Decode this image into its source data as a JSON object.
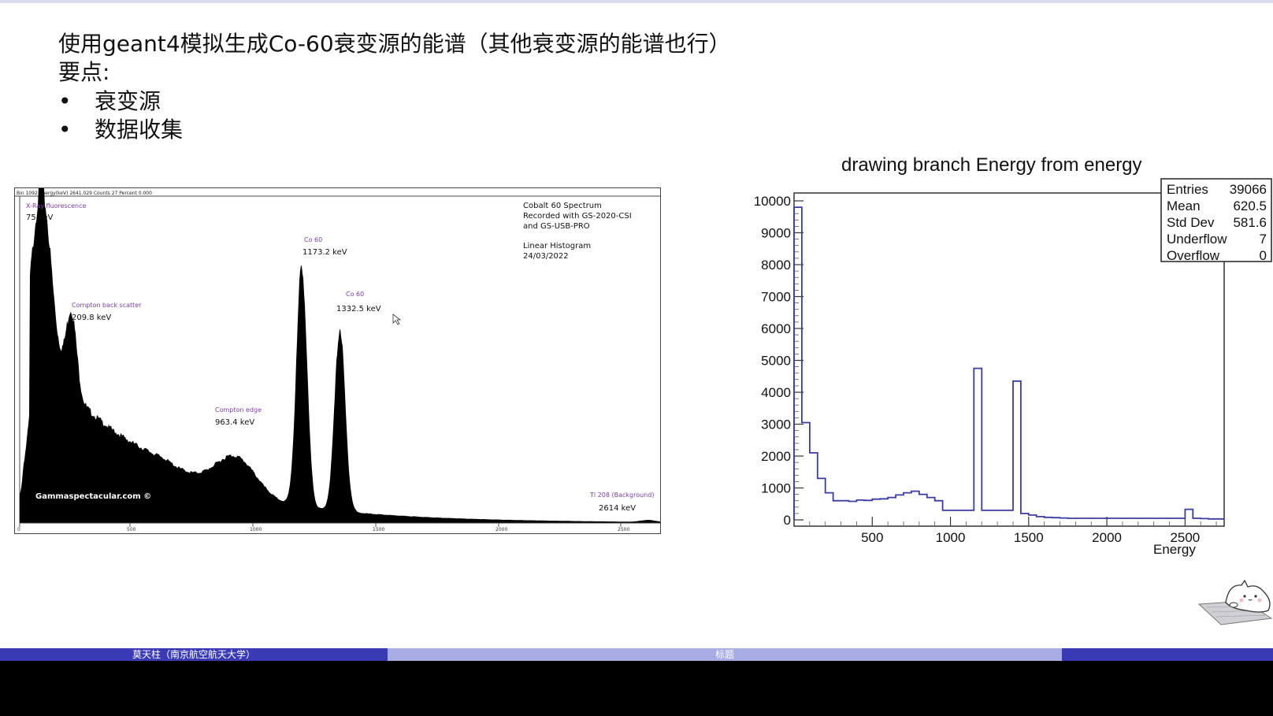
{
  "slide": {
    "title": "使用geant4模拟生成Co-60衰变源的能谱（其他衰变源的能谱也行）",
    "subtitle": "要点:",
    "bullets": [
      "衰变源",
      "数据收集"
    ]
  },
  "footer": {
    "left": "莫天柱（南京航空航天大学）",
    "center": "标题",
    "right": ""
  },
  "left_figure": {
    "status_bar": "Bin 1092  Energy(keV) 2641.029  Counts 27  Percent 0.000",
    "info_lines": [
      "Cobalt 60 Spectrum",
      "Recorded with GS-2020-CSI",
      "and GS-USB-PRO",
      "Linear Histogram",
      "24/03/2022"
    ],
    "watermark": "Gammaspectacular.com ©",
    "peaks": [
      {
        "label": "X-Ray fluorescence",
        "energy": "75 keV"
      },
      {
        "label": "Compton back scatter",
        "energy": "209.8 keV"
      },
      {
        "label": "Compton edge",
        "energy": "963.4 keV"
      },
      {
        "label": "Co 60",
        "energy": "1173.2 keV"
      },
      {
        "label": "Co 60",
        "energy": "1332.5 keV"
      },
      {
        "label": "Tl 208 (Background)",
        "energy": "2614 keV"
      }
    ],
    "x_ticks": [
      "0",
      "500",
      "1000",
      "1500",
      "2000",
      "2500"
    ],
    "fill_color": "#000000",
    "label_color": "#7a3fa0"
  },
  "chart_data": {
    "type": "bar",
    "title": "drawing branch Energy from energy",
    "xlabel": "Energy",
    "ylabel": "",
    "xlim": [
      0,
      2750
    ],
    "ylim": [
      0,
      10000
    ],
    "x_ticks": [
      500,
      1000,
      1500,
      2000,
      2500
    ],
    "y_ticks": [
      0,
      1000,
      2000,
      3000,
      4000,
      5000,
      6000,
      7000,
      8000,
      9000,
      10000
    ],
    "bin_width": 50,
    "bin_start": 0,
    "values": [
      9800,
      3050,
      2100,
      1300,
      850,
      600,
      600,
      580,
      620,
      610,
      650,
      660,
      700,
      780,
      850,
      900,
      800,
      700,
      600,
      300,
      300,
      300,
      300,
      4750,
      300,
      300,
      300,
      300,
      4350,
      200,
      150,
      100,
      80,
      70,
      60,
      50,
      50,
      50,
      50,
      50,
      50,
      50,
      50,
      50,
      50,
      50,
      50,
      50,
      50,
      50,
      330,
      50,
      40,
      30,
      30
    ],
    "line_color": "#3b3ba0",
    "stats": {
      "Entries": "39066",
      "Mean": "620.5",
      "Std Dev": "581.6",
      "Underflow": "7",
      "Overflow": "0"
    }
  }
}
